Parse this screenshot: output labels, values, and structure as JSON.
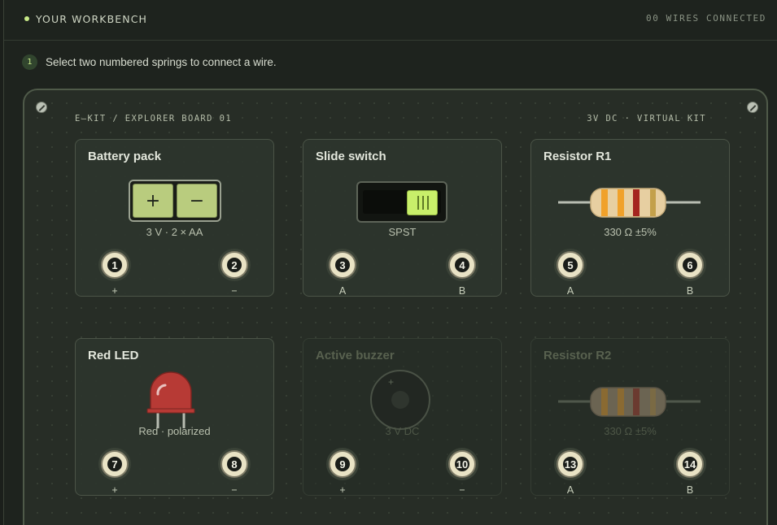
{
  "header": {
    "title": "YOUR WORKBENCH",
    "wires_status": "00 WIRES CONNECTED"
  },
  "instruction": {
    "step": "1",
    "text": "Select two numbered springs to connect a wire."
  },
  "board": {
    "left_label": "E—KIT / EXPLORER BOARD 01",
    "right_label": "3V DC · VIRTUAL KIT"
  },
  "colors": {
    "accent": "#c7e887",
    "led": "#b73a35",
    "battery": "#b9cc7e",
    "switch_knob": "#c8ef6a"
  },
  "components": [
    {
      "name": "Battery pack",
      "spec": "3 V · 2 × AA",
      "enabled": true,
      "battery_symbols": [
        "+",
        "−"
      ],
      "terminals": [
        {
          "num": "1",
          "label": "+"
        },
        {
          "num": "2",
          "label": "−"
        }
      ]
    },
    {
      "name": "Slide switch",
      "spec": "SPST",
      "enabled": true,
      "switch_position": "on",
      "terminals": [
        {
          "num": "3",
          "label": "A"
        },
        {
          "num": "4",
          "label": "B"
        }
      ]
    },
    {
      "name": "Resistor R1",
      "spec": "330 Ω ±5%",
      "enabled": true,
      "bands": [
        "#f0a12a",
        "#f0a12a",
        "#a5251f",
        "#c3a04a"
      ],
      "terminals": [
        {
          "num": "5",
          "label": "A"
        },
        {
          "num": "6",
          "label": "B"
        }
      ]
    },
    {
      "name": "Red LED",
      "spec": "Red · polarized",
      "enabled": true,
      "terminals": [
        {
          "num": "7",
          "label": "+"
        },
        {
          "num": "8",
          "label": "−"
        }
      ]
    },
    {
      "name": "Active buzzer",
      "spec": "3 V DC",
      "enabled": false,
      "buzzer_mark": "+",
      "terminals": [
        {
          "num": "9",
          "label": "+"
        },
        {
          "num": "10",
          "label": "−"
        }
      ]
    },
    {
      "name": "Resistor R2",
      "spec": "330 Ω ±5%",
      "enabled": false,
      "terminals": [
        {
          "num": "13",
          "label": "A"
        },
        {
          "num": "14",
          "label": "B"
        }
      ]
    }
  ]
}
